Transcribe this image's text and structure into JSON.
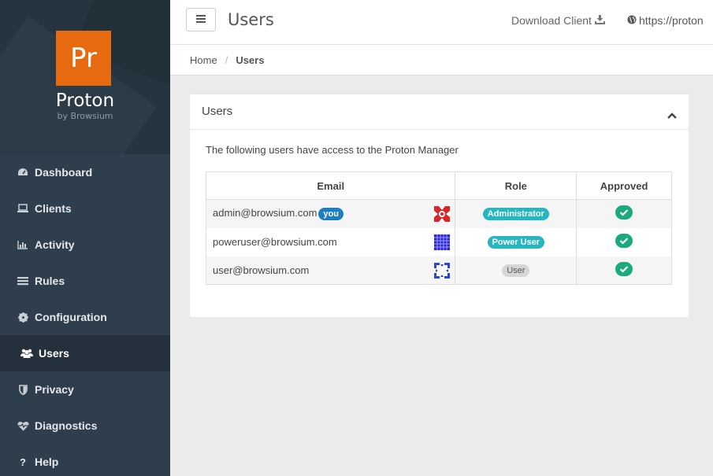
{
  "brand": {
    "logo": "Pr",
    "name": "Proton",
    "subtitle": "by Browsium"
  },
  "sidebar": {
    "items": [
      {
        "label": "Dashboard",
        "icon": "dashboard-icon"
      },
      {
        "label": "Clients",
        "icon": "laptop-icon"
      },
      {
        "label": "Activity",
        "icon": "bar-chart-icon"
      },
      {
        "label": "Rules",
        "icon": "list-icon"
      },
      {
        "label": "Configuration",
        "icon": "gear-icon"
      },
      {
        "label": "Users",
        "icon": "users-icon",
        "active": true
      },
      {
        "label": "Privacy",
        "icon": "shield-icon"
      },
      {
        "label": "Diagnostics",
        "icon": "heartbeat-icon"
      },
      {
        "label": "Help",
        "icon": "question-icon"
      }
    ]
  },
  "header": {
    "title": "Users",
    "download_label": "Download Client",
    "url_text": "https://proton"
  },
  "breadcrumb": {
    "home": "Home",
    "separator": "/",
    "current": "Users"
  },
  "panel": {
    "title": "Users",
    "description": "The following users have access to the Proton Manager",
    "columns": [
      "Email",
      "Role",
      "Approved"
    ],
    "rows": [
      {
        "email": "admin@browsium.com",
        "you_badge": "you",
        "role": "Administrator",
        "approved": true,
        "avatar_color": "#d9262a"
      },
      {
        "email": "poweruser@browsium.com",
        "you_badge": "",
        "role": "Power User",
        "approved": true,
        "avatar_color": "#2727d6"
      },
      {
        "email": "user@browsium.com",
        "you_badge": "",
        "role": "User",
        "approved": true,
        "avatar_color": "#2b46d8"
      }
    ]
  },
  "colors": {
    "sidebar_bg": "#2f3e4d",
    "brand_orange": "#e86a10",
    "accent_teal": "#25b7bf",
    "you_blue": "#1e7dc1",
    "check_green": "#1aaa7e"
  }
}
